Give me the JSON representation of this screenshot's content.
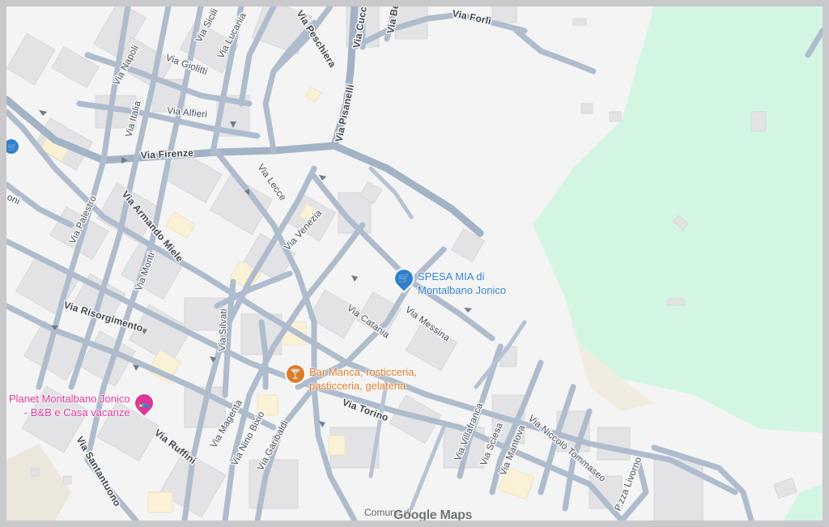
{
  "streets": {
    "via_peschiera": "Via Peschiera",
    "via_cucc": "Via Cucc",
    "via_be": "Via Be",
    "via_forli": "Via Forlì",
    "via_sicilia": "Via Sicili",
    "via_lucania": "Via Lucania",
    "via_napoli": "Via Napoli",
    "via_giolitti": "Via Giolitti",
    "via_italia": "Via Italia",
    "via_alfieri": "Via Alfieri",
    "via_pisanelli": "Via Pisanelli",
    "via_firenze": "Via Firenze",
    "via_lecce": "Via Lecce",
    "via_palestro": "Via Palestro",
    "via_armando_miele": "Via Armando Miele",
    "via_venezia": "Via Venezia",
    "via_monti": "Via Monti",
    "via_risorgimento": "Via Risorgimento",
    "via_silvati": "Via Silvati",
    "via_catania": "Via Catania",
    "via_messina": "Via Messina",
    "via_torino": "Via Torino",
    "via_villafranca": "Via Villafranca",
    "via_sciesa": "Via Sciesa",
    "via_mantova": "Via Mantova",
    "via_niccolo_tommaseo": "Via Niccolò Tommaseo",
    "via_magenta": "Via Magenta",
    "via_nino_bixio": "Via Nino Bixio",
    "via_garibaldi": "Via Garibaldi",
    "via_ruffini": "Via Ruffini",
    "via_santantuono": "Via Santantuono",
    "pza_livorno": "P.zza Livorno",
    "oni_fragment": "oni"
  },
  "pois": {
    "spesa_mia": {
      "line1": "SPESA MIA di",
      "line2": "Montalbano Jonico",
      "icon": "shopping-cart-icon",
      "color": "#2f7fd0"
    },
    "bar_manca": {
      "line1": "Bar Manca, rosticceria,",
      "line2": "pasticceria, gelateria",
      "icon": "cocktail-icon",
      "color": "#e07b28"
    },
    "planet": {
      "line1": "Planet Montalbano Jonico",
      "line2": "- B&B e Casa vacanze",
      "icon": "bed-icon",
      "color": "#e0359a"
    }
  },
  "attribution": {
    "comune": "Comune di",
    "logo": "Google Maps"
  },
  "colors": {
    "park": "#d3f6e3",
    "background": "#f4f4f4",
    "road": "#aebccd",
    "building": "#e3e3e6",
    "building_highlight": "#fbf1d6",
    "sand": "#f1ece0"
  }
}
